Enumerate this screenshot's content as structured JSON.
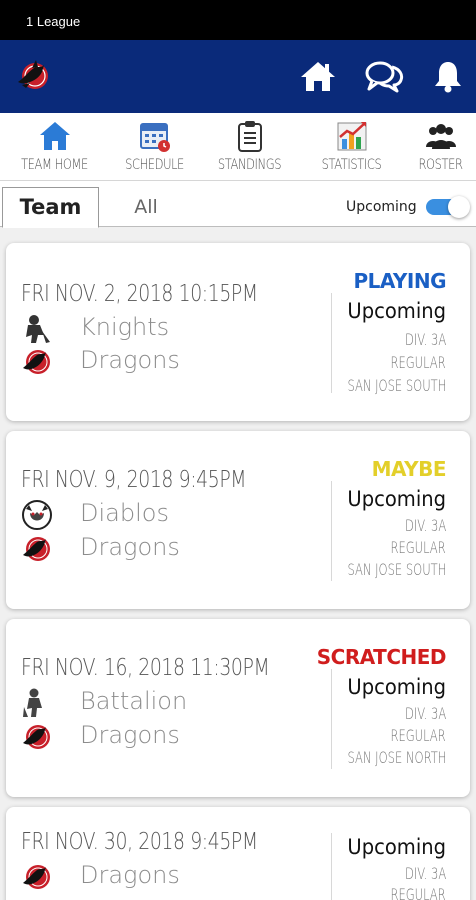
{
  "status_bar": {
    "carrier": "1 League"
  },
  "app_bar": {
    "logo": "dragon-logo",
    "icons": [
      "home-icon",
      "chat-icon",
      "bell-icon"
    ]
  },
  "nav": {
    "items": [
      {
        "label": "TEAM HOME",
        "icon": "house-icon"
      },
      {
        "label": "SCHEDULE",
        "icon": "calendar-icon"
      },
      {
        "label": "STANDINGS",
        "icon": "clipboard-icon"
      },
      {
        "label": "STATISTICS",
        "icon": "chart-icon"
      },
      {
        "label": "ROSTER",
        "icon": "people-icon"
      }
    ]
  },
  "tabs": {
    "team": "Team",
    "all": "All"
  },
  "toggle": {
    "label": "Upcoming",
    "on": true
  },
  "colors": {
    "primary": "#0a2a7a",
    "playing": "#1a5fc4",
    "maybe": "#e3cf2a",
    "scratched": "#d01d1d",
    "toggle": "#3a8fe0"
  },
  "games": [
    {
      "date": "FRI NOV. 2, 2018 10:15PM",
      "home": "Knights",
      "away": "Dragons",
      "status": "PLAYING",
      "state": "Upcoming",
      "division": "DIV. 3A",
      "type": "REGULAR",
      "location": "SAN JOSE SOUTH"
    },
    {
      "date": "FRI NOV. 9, 2018 9:45PM",
      "home": "Diablos",
      "away": "Dragons",
      "status": "MAYBE",
      "state": "Upcoming",
      "division": "DIV. 3A",
      "type": "REGULAR",
      "location": "SAN JOSE SOUTH"
    },
    {
      "date": "FRI NOV. 16, 2018 11:30PM",
      "home": "Battalion",
      "away": "Dragons",
      "status": "SCRATCHED",
      "state": "Upcoming",
      "division": "DIV. 3A",
      "type": "REGULAR",
      "location": "SAN JOSE NORTH"
    },
    {
      "date": "FRI NOV. 30, 2018 9:45PM",
      "home": "Dragons",
      "state": "Upcoming",
      "division": "DIV. 3A",
      "type": "REGULAR"
    }
  ]
}
